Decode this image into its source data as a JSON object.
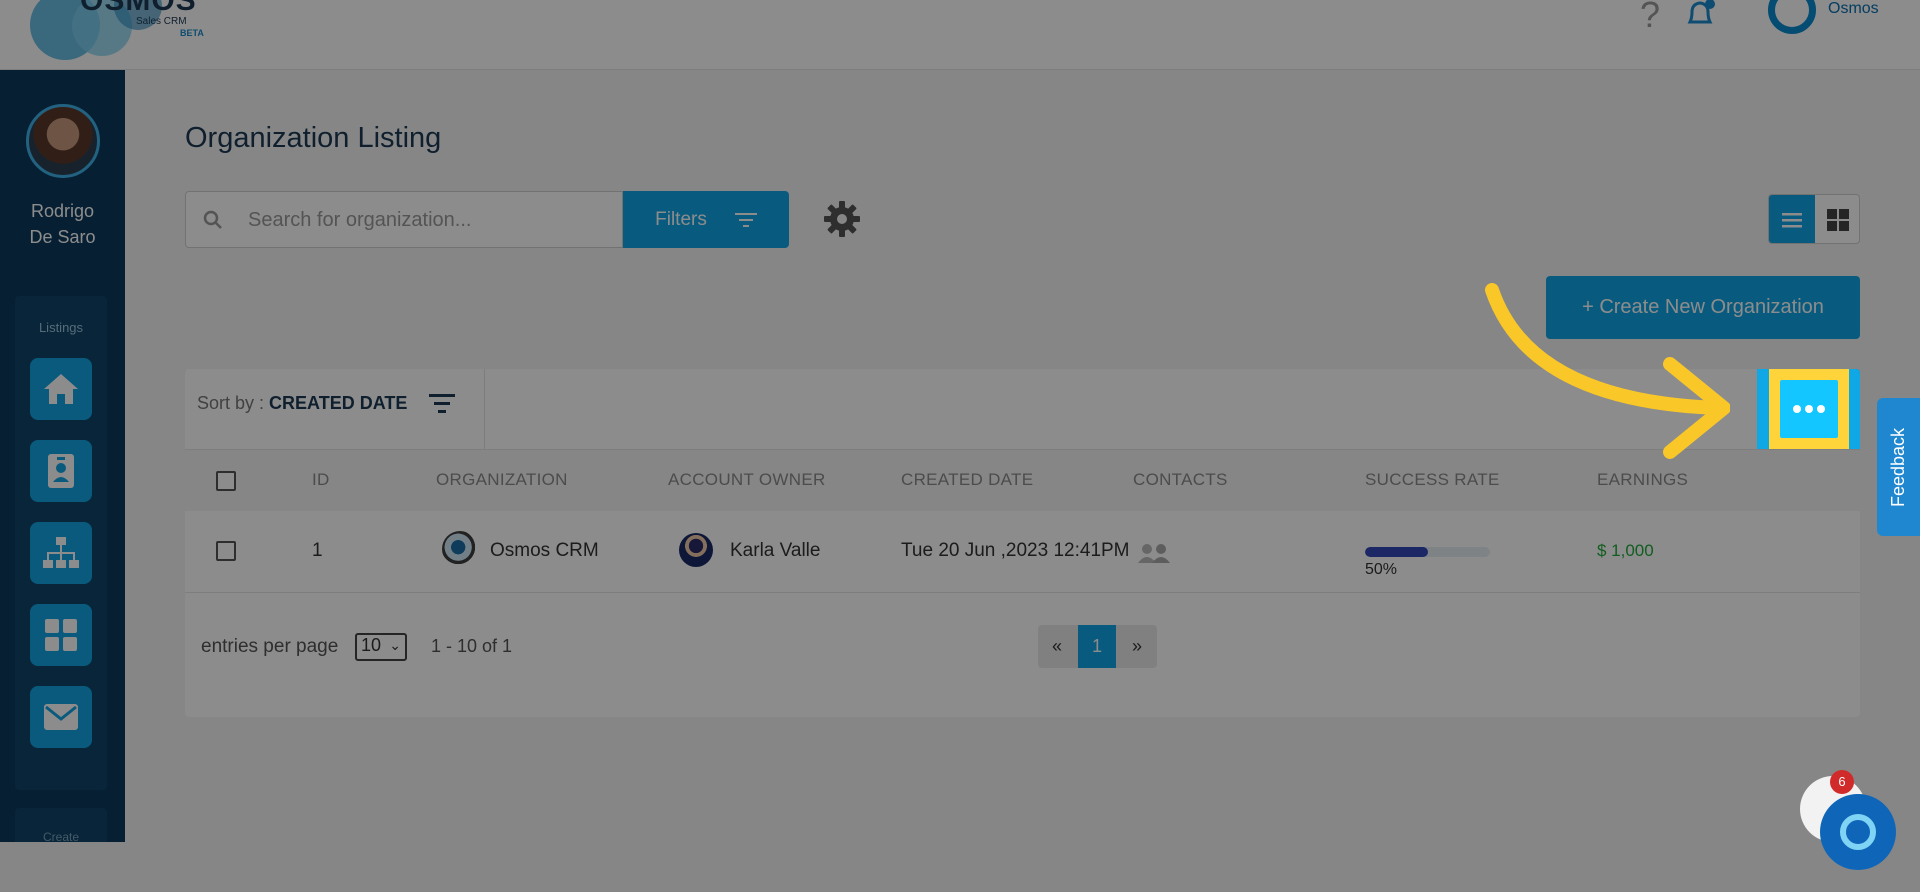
{
  "header": {
    "logo_word": "OSMOS",
    "logo_sub": "Sales CRM",
    "logo_beta": "BETA",
    "help_icon": "question-icon",
    "bell_icon": "bell-icon",
    "user_name": "Osmos"
  },
  "sidebar": {
    "user_name": "Rodrigo De Saro",
    "section_label": "Listings",
    "items": [
      {
        "icon": "home-icon"
      },
      {
        "icon": "contact-card-icon"
      },
      {
        "icon": "org-chart-icon"
      },
      {
        "icon": "grid-icon"
      },
      {
        "icon": "mail-icon"
      }
    ],
    "bottom_label": "Create"
  },
  "page": {
    "title": "Organization Listing",
    "search_placeholder": "Search for organization...",
    "filters_label": "Filters",
    "create_label": "+ Create New Organization"
  },
  "table": {
    "sort_prefix": "Sort by : ",
    "sort_value": "CREATED DATE",
    "columns": [
      "ID",
      "ORGANIZATION",
      "ACCOUNT OWNER",
      "CREATED DATE",
      "CONTACTS",
      "SUCCESS RATE",
      "EARNINGS"
    ],
    "rows": [
      {
        "id": "1",
        "organization": "Osmos CRM",
        "account_owner": "Karla Valle",
        "created_date": "Tue 20 Jun ,2023 12:41PM",
        "success_rate": 0.5,
        "success_rate_label": "50%",
        "earnings": "$ 1,000"
      }
    ],
    "entries_label": "entries per page",
    "entries_value": "10",
    "range_label": "1 - 10 of 1",
    "pager": {
      "prev": "«",
      "current": "1",
      "next": "»"
    }
  },
  "overlay": {
    "feedback_label": "Feedback",
    "chat_badge": "6"
  },
  "colors": {
    "brand": "#10a7e6",
    "sidebar": "#0b3a5c",
    "highlight": "#ffd43b",
    "earnings": "#22aa3b"
  }
}
